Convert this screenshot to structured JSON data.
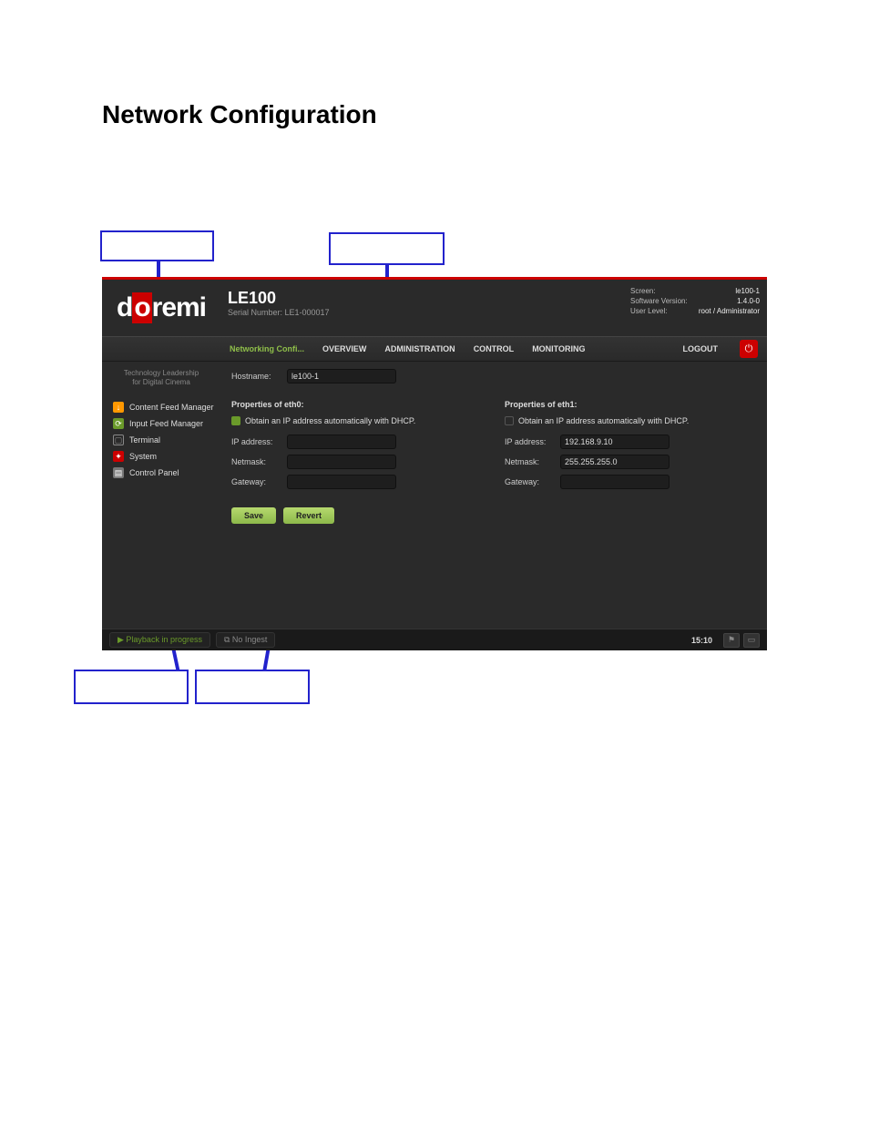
{
  "doc": {
    "heading": "Network Configuration",
    "bullets_top": [
      "(hidden instructional text)"
    ],
    "bullets_bottom": [
      "",
      "",
      ""
    ]
  },
  "callouts": {
    "top_left": "",
    "top_right": "",
    "bottom_left": "",
    "bottom_right": ""
  },
  "app": {
    "logo": "doremi",
    "product": "LE100",
    "serial_label": "Serial Number: LE1-000017",
    "status": {
      "screen_label": "Screen:",
      "screen_value": "le100-1",
      "sw_label": "Software Version:",
      "sw_value": "1.4.0-0",
      "user_label": "User Level:",
      "user_value": "root / Administrator"
    },
    "nav": {
      "active": "Networking Confi...",
      "overview": "OVERVIEW",
      "administration": "ADMINISTRATION",
      "control": "CONTROL",
      "monitoring": "MONITORING",
      "logout": "LOGOUT"
    },
    "sidebar": {
      "tagline1": "Technology Leadership",
      "tagline2": "for Digital Cinema",
      "items": [
        {
          "label": "Content Feed Manager"
        },
        {
          "label": "Input Feed Manager"
        },
        {
          "label": "Terminal"
        },
        {
          "label": "System"
        },
        {
          "label": "Control Panel"
        }
      ]
    },
    "main": {
      "hostname_label": "Hostname:",
      "hostname_value": "le100-1",
      "eth0": {
        "heading": "Properties of eth0:",
        "dhcp_label": "Obtain an IP address automatically with DHCP.",
        "ip_label": "IP address:",
        "ip_value": "",
        "nm_label": "Netmask:",
        "nm_value": "",
        "gw_label": "Gateway:",
        "gw_value": ""
      },
      "eth1": {
        "heading": "Properties of eth1:",
        "dhcp_label": "Obtain an IP address automatically with DHCP.",
        "ip_label": "IP address:",
        "ip_value": "192.168.9.10",
        "nm_label": "Netmask:",
        "nm_value": "255.255.255.0",
        "gw_label": "Gateway:",
        "gw_value": ""
      },
      "save": "Save",
      "revert": "Revert"
    },
    "footer": {
      "playback": "Playback in progress",
      "ingest": "No Ingest",
      "time": "15:10"
    }
  }
}
